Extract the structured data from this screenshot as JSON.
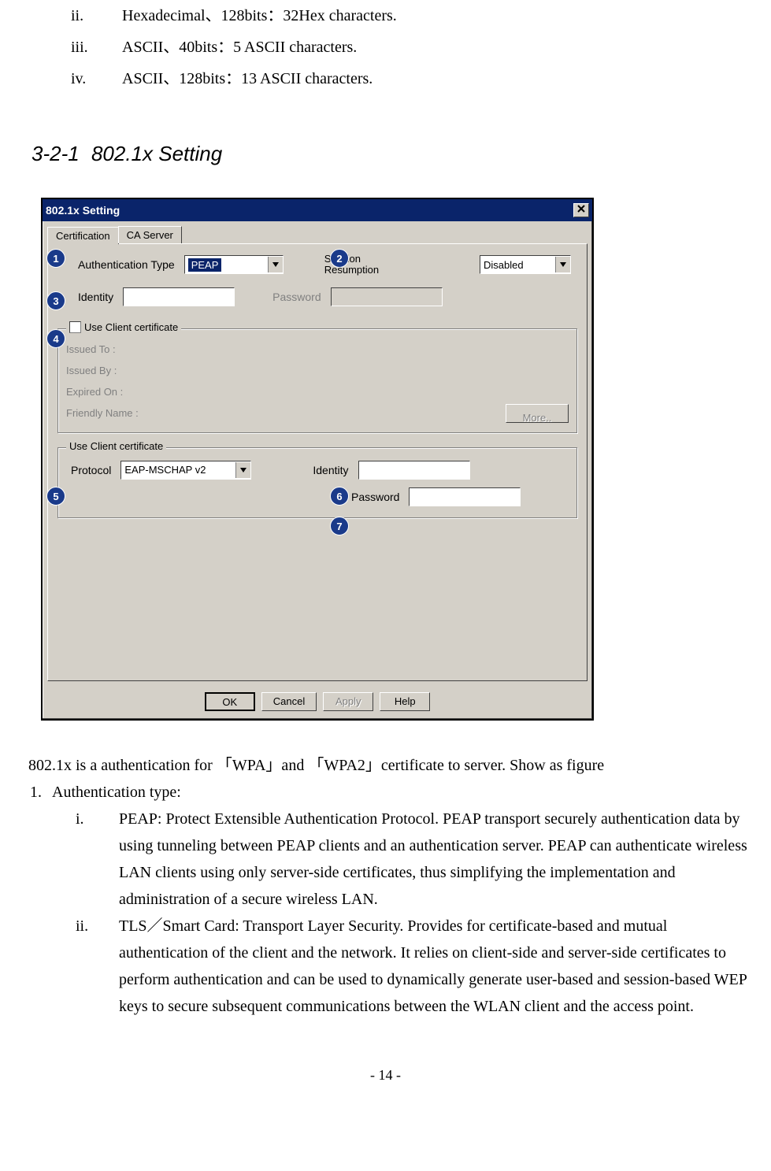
{
  "topList": [
    {
      "num": "ii.",
      "text": "Hexadecimal、128bits：32Hex characters."
    },
    {
      "num": "iii.",
      "text": "ASCII、40bits：5 ASCII characters."
    },
    {
      "num": "iv.",
      "text": "ASCII、128bits：13 ASCII characters."
    }
  ],
  "sectionPrefix": "3-2-1",
  "sectionTitle": "802.1x Setting",
  "dialog": {
    "title": "802.1x Setting",
    "closeX": "✕",
    "tabs": {
      "active": "Certification",
      "inactive": "CA Server"
    },
    "authTypeLabel": "Authentication Type",
    "authTypeValue": "PEAP",
    "sessionLabel1": "Session",
    "sessionLabel2": "Resumption",
    "sessionValue": "Disabled",
    "identityLabel": "Identity",
    "passwordLabel": "Password",
    "useClientCert": "Use Client certificate",
    "issuedTo": "Issued To :",
    "issuedBy": "Issued By :",
    "expiredOn": "Expired On :",
    "friendlyName": "Friendly Name :",
    "moreBtn": "More..",
    "group2Legend": "Use Client certificate",
    "protocolLabel": "Protocol",
    "protocolValue": "EAP-MSCHAP v2",
    "identity2Label": "Identity",
    "password2Label": "Password",
    "okBtn": "OK",
    "cancelBtn": "Cancel",
    "applyBtn": "Apply",
    "helpBtn": "Help",
    "callouts": {
      "c1": "1",
      "c2": "2",
      "c3": "3",
      "c4": "4",
      "c5": "5",
      "c6": "6",
      "c7": "7"
    }
  },
  "para1": "802.1x is a authentication for 「WPA」and 「WPA2」certificate to server. Show as figure",
  "list1": {
    "num": "1.",
    "text": "Authentication type:"
  },
  "subItems": [
    {
      "num": "i.",
      "text": "PEAP: Protect Extensible Authentication Protocol. PEAP transport securely authentication data by using tunneling between PEAP clients and an authentication server. PEAP can authenticate wireless LAN clients using only server-side certificates, thus simplifying the implementation and administration of a secure wireless LAN."
    },
    {
      "num": "ii.",
      "text": "TLS／Smart Card: Transport Layer Security. Provides for certificate-based and mutual authentication of the client and the network. It relies on client-side and server-side certificates to perform authentication and can be used to dynamically generate user-based and session-based WEP keys to secure subsequent communications between the WLAN client and the access point."
    }
  ],
  "pageNum": "- 14 -"
}
